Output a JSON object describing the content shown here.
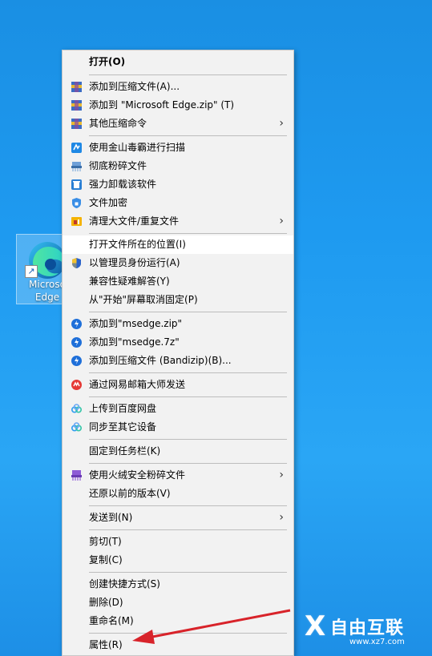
{
  "desktop_icon": {
    "label_line1": "Microso",
    "label_line2": "Edge"
  },
  "menu": {
    "open": "打开(O)",
    "add_archive": "添加到压缩文件(A)...",
    "add_zip": "添加到 \"Microsoft Edge.zip\" (T)",
    "other_compress": "其他压缩命令",
    "jinshan_scan": "使用金山毒霸进行扫描",
    "shred": "彻底粉碎文件",
    "force_uninstall": "强力卸载该软件",
    "encrypt": "文件加密",
    "clean_dup": "清理大文件/重复文件",
    "open_location": "打开文件所在的位置(I)",
    "run_admin": "以管理员身份运行(A)",
    "compat": "兼容性疑难解答(Y)",
    "unpin_start": "从\"开始\"屏幕取消固定(P)",
    "bz_zip": "添加到\"msedge.zip\"",
    "bz_7z": "添加到\"msedge.7z\"",
    "bz_archive": "添加到压缩文件 (Bandizip)(B)...",
    "netease": "通过网易邮箱大师发送",
    "baidu_upload": "上传到百度网盘",
    "sync": "同步至其它设备",
    "pin_taskbar": "固定到任务栏(K)",
    "huorong_shred": "使用火绒安全粉碎文件",
    "restore": "还原以前的版本(V)",
    "send_to": "发送到(N)",
    "cut": "剪切(T)",
    "copy": "复制(C)",
    "shortcut": "创建快捷方式(S)",
    "delete": "删除(D)",
    "rename": "重命名(M)",
    "properties": "属性(R)"
  },
  "watermark": {
    "brand": "自由互联",
    "url": "www.xz7.com"
  },
  "colors": {
    "menu_bg": "#f2f2f2",
    "accent_arrow": "#d8232a",
    "desktop": "#1e9af0"
  }
}
